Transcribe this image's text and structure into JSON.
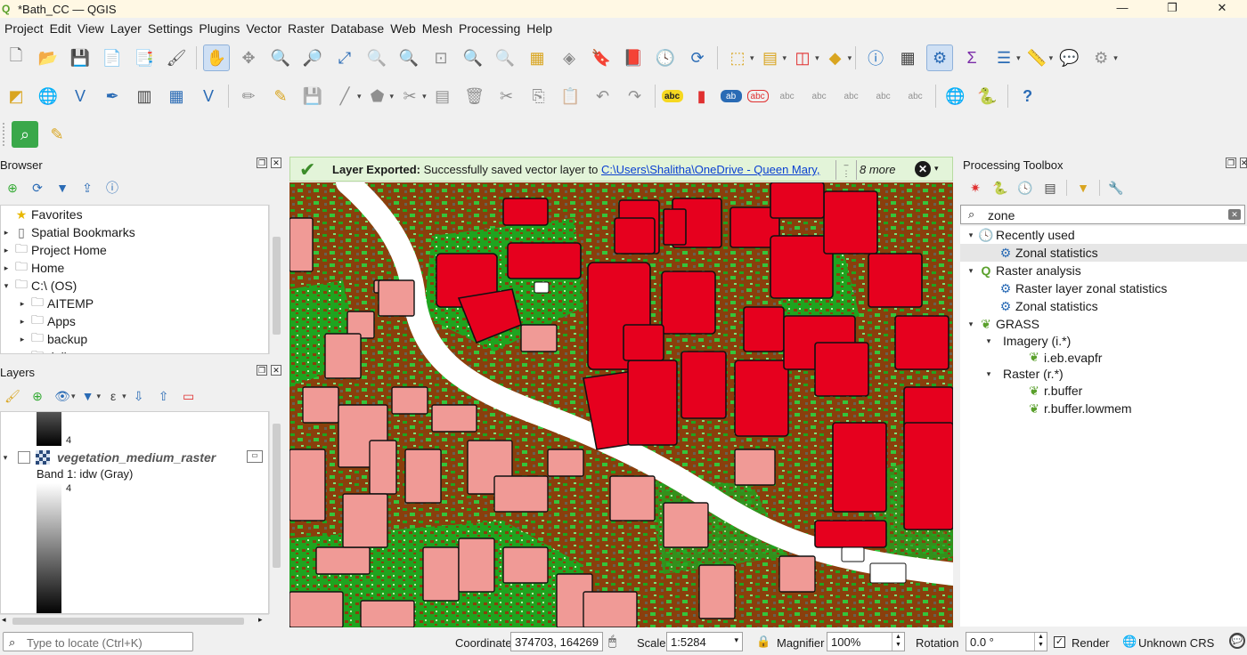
{
  "window": {
    "title": "*Bath_CC — QGIS",
    "controls": [
      "—",
      "❐",
      "✕"
    ]
  },
  "menu": [
    "Project",
    "Edit",
    "View",
    "Layer",
    "Settings",
    "Plugins",
    "Vector",
    "Raster",
    "Database",
    "Web",
    "Mesh",
    "Processing",
    "Help"
  ],
  "browser": {
    "title": "Browser",
    "items": [
      {
        "label": "Favorites",
        "icon": "star-icon",
        "expander": ""
      },
      {
        "label": "Spatial Bookmarks",
        "icon": "bookmark-icon",
        "expander": "▸"
      },
      {
        "label": "Project Home",
        "icon": "folder-icon",
        "expander": "▸"
      },
      {
        "label": "Home",
        "icon": "folder-icon",
        "expander": "▸"
      },
      {
        "label": "C:\\ (OS)",
        "icon": "folder-icon",
        "expander": "▾"
      },
      {
        "label": "AITEMP",
        "icon": "folder-icon",
        "expander": "▸"
      },
      {
        "label": "Apps",
        "icon": "folder-icon",
        "expander": "▸"
      },
      {
        "label": "backup",
        "icon": "folder-icon",
        "expander": "▸"
      },
      {
        "label": "dell",
        "icon": "folder-icon",
        "expander": "▸"
      }
    ]
  },
  "layers": {
    "title": "Layers",
    "legend_top_value": "4",
    "layer_name": "vegetation_medium_raster",
    "band_label": "Band 1: idw (Gray)",
    "legend_value": "4"
  },
  "message": {
    "title": "Layer Exported:",
    "text": "Successfully saved vector layer to",
    "link": "C:\\Users\\Shalitha\\OneDrive - Queen Mary,",
    "more": "8 more"
  },
  "processing": {
    "title": "Processing Toolbox",
    "search_value": "zone",
    "tree": [
      {
        "label": "Recently used",
        "level": 0,
        "icon": "clock-icon",
        "expander": "▾",
        "selected": false
      },
      {
        "label": "Zonal statistics",
        "level": 1,
        "icon": "gear-icon",
        "expander": "",
        "selected": true
      },
      {
        "label": "Raster analysis",
        "level": 0,
        "icon": "qgis-icon",
        "expander": "▾",
        "selected": false
      },
      {
        "label": "Raster layer zonal statistics",
        "level": 1,
        "icon": "gear-icon",
        "expander": "",
        "selected": false
      },
      {
        "label": "Zonal statistics",
        "level": 1,
        "icon": "gear-icon",
        "expander": "",
        "selected": false
      },
      {
        "label": "GRASS",
        "level": 0,
        "icon": "grass-icon",
        "expander": "▾",
        "selected": false
      },
      {
        "label": "Imagery (i.*)",
        "level": 1,
        "icon": "",
        "expander": "▾",
        "selected": false
      },
      {
        "label": "i.eb.evapfr",
        "level": 2,
        "icon": "grass-icon",
        "expander": "",
        "selected": false
      },
      {
        "label": "Raster (r.*)",
        "level": 1,
        "icon": "",
        "expander": "▾",
        "selected": false
      },
      {
        "label": "r.buffer",
        "level": 2,
        "icon": "grass-icon",
        "expander": "",
        "selected": false
      },
      {
        "label": "r.buffer.lowmem",
        "level": 2,
        "icon": "grass-icon",
        "expander": "",
        "selected": false
      }
    ]
  },
  "status": {
    "locate_placeholder": "Type to locate (Ctrl+K)",
    "coordinate_label": "Coordinate",
    "coordinate_value": "374703, 164269",
    "scale_label": "Scale",
    "scale_value": "1:5284",
    "magnifier_label": "Magnifier",
    "magnifier_value": "100%",
    "rotation_label": "Rotation",
    "rotation_value": "0.0 °",
    "render_label": "Render",
    "crs_label": "Unknown CRS"
  },
  "colors": {
    "map_ground": "#8a3f0c",
    "vegetation": "#1fa41f",
    "buildings_high": "#e6001e",
    "buildings_low": "#f09a96",
    "river": "#ffffff",
    "message_bg": "#e3f4d9"
  }
}
